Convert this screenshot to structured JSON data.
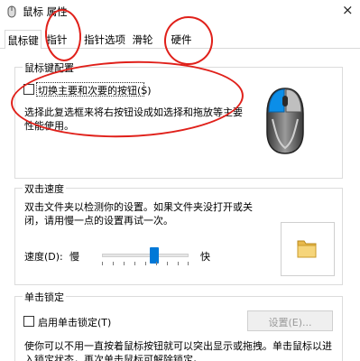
{
  "window": {
    "title": "鼠标 属性",
    "close_glyph": "×"
  },
  "tabs": [
    {
      "label": "鼠标键",
      "active": true
    },
    {
      "label": "指针",
      "active": false
    },
    {
      "label": "指针选项",
      "active": false
    },
    {
      "label": "滑轮",
      "active": false
    },
    {
      "label": "硬件",
      "active": false
    }
  ],
  "button_config": {
    "legend": "鼠标键配置",
    "checkbox_label": "切换主要和次要的按钮(S)",
    "checked": false,
    "description_line1": "选择此复选框来将右按钮设成如选择和拖放等主要",
    "description_line2": "性能使用。"
  },
  "double_click": {
    "legend": "双击速度",
    "description_line1": "双击文件夹以检测你的设置。如果文件夹没打开或关",
    "description_line2": "闭，请用慢一点的设置再试一次。",
    "speed_label": "速度(D):",
    "slow_label": "慢",
    "fast_label": "快",
    "slider_value": 0.6
  },
  "click_lock": {
    "legend": "单击锁定",
    "checkbox_label": "启用单击锁定(T)",
    "checked": false,
    "settings_button": "设置(E)...",
    "description_line1": "使你可以不用一直按着鼠标按钮就可以突出显示或拖拽。单击鼠标以进",
    "description_line2": "入锁定状态，再次单击鼠标可解除锁定。"
  },
  "colors": {
    "accent": "#0078d7",
    "annotation": "#e0201a",
    "mouse_highlight": "#0b8ee8",
    "folder": "#f6d57a"
  },
  "icons": {
    "app": "mouse-icon",
    "mouse_illustration": "mouse-illustration-icon",
    "test_folder": "folder-icon"
  }
}
